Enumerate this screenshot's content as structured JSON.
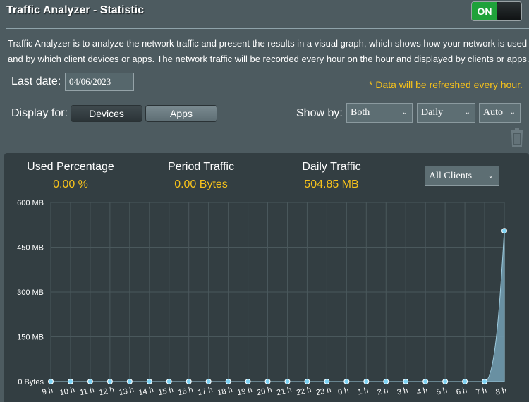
{
  "header": {
    "title": "Traffic Analyzer - Statistic",
    "toggle_label": "ON"
  },
  "description": "Traffic Analyzer is to analyze the network traffic and present the results in a visual graph, which shows how your network is used and by which client devices or apps. The network traffic will be recorded every hour on the hour and displayed by clients or apps.",
  "last_date": {
    "label": "Last date:",
    "value": "04/06/2023"
  },
  "refresh_note": "* Data will be refreshed every hour.",
  "display_for": {
    "label": "Display for:",
    "devices": "Devices",
    "apps": "Apps"
  },
  "show_by": {
    "label": "Show by:",
    "direction": "Both",
    "period": "Daily",
    "scale": "Auto"
  },
  "stats": {
    "used_percentage": {
      "label": "Used Percentage",
      "value": "0.00 %"
    },
    "period_traffic": {
      "label": "Period Traffic",
      "value": "0.00 Bytes"
    },
    "daily_traffic": {
      "label": "Daily Traffic",
      "value": "504.85 MB"
    }
  },
  "clients_filter": "All Clients",
  "colors": {
    "accent_yellow": "#f7c21b",
    "point": "#7fd4f5",
    "area": "#6f99ad",
    "on_green": "#1fa23a"
  },
  "chart_data": {
    "type": "area",
    "x": [
      "9 h",
      "10 h",
      "11 h",
      "12 h",
      "13 h",
      "14 h",
      "15 h",
      "16 h",
      "17 h",
      "18 h",
      "19 h",
      "20 h",
      "21 h",
      "22 h",
      "23 h",
      "0 h",
      "1 h",
      "2 h",
      "3 h",
      "4 h",
      "5 h",
      "6 h",
      "7 h",
      "8 h"
    ],
    "values": [
      0,
      0,
      0,
      0,
      0,
      0,
      0,
      0,
      0,
      0,
      0,
      0,
      0,
      0,
      0,
      0,
      0,
      0,
      0,
      0,
      0,
      0,
      0,
      505
    ],
    "y_ticks": [
      0,
      150,
      300,
      450,
      600
    ],
    "y_tick_labels": [
      "0 Bytes",
      "150 MB",
      "300 MB",
      "450 MB",
      "600 MB"
    ],
    "ylim": [
      0,
      600
    ],
    "grid": true
  }
}
